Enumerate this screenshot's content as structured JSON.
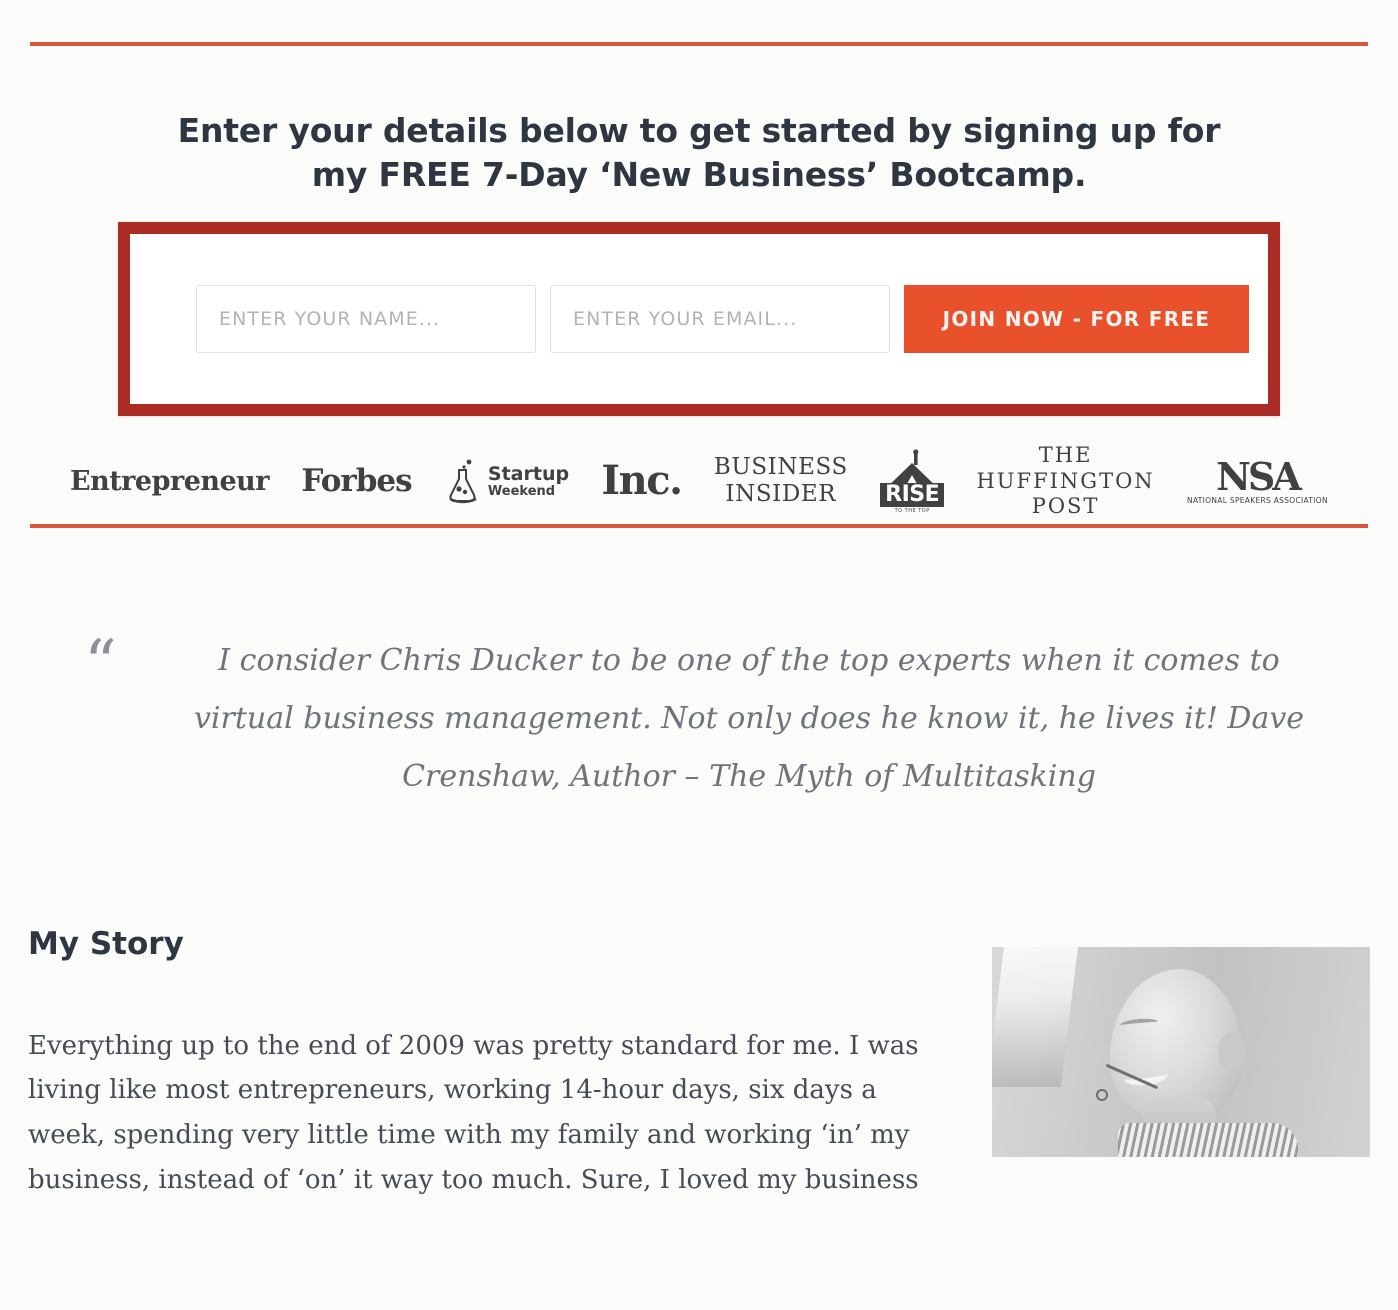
{
  "theme": {
    "rule_color": "#d9563a",
    "form_border_color": "#ab2b25",
    "button_color": "#e8512c",
    "heading_color": "#2e3642",
    "quote_color": "#6e737c"
  },
  "optin": {
    "heading_line1": "Enter your details below to get started by signing up for",
    "heading_line2": "my FREE 7-Day ‘New Business’ Bootcamp.",
    "name_placeholder": "ENTER YOUR NAME...",
    "email_placeholder": "ENTER YOUR EMAIL...",
    "name_value": "",
    "email_value": "",
    "submit_label": "JOIN NOW - FOR FREE"
  },
  "press_logos": [
    {
      "id": "entrepreneur",
      "name": "Entrepreneur"
    },
    {
      "id": "forbes",
      "name": "Forbes"
    },
    {
      "id": "startup-weekend",
      "name": "Startup",
      "name2": "Weekend"
    },
    {
      "id": "inc",
      "name": "Inc."
    },
    {
      "id": "business-insider",
      "name": "BUSINESS",
      "name2": "INSIDER"
    },
    {
      "id": "rise",
      "name": "RISE",
      "name2": "TO THE TOP"
    },
    {
      "id": "huffington-post",
      "name": "THE",
      "name2": "HUFFINGTON",
      "name3": "POST"
    },
    {
      "id": "nsa",
      "name": "NSA",
      "name2": "NATIONAL SPEAKERS ASSOCIATION"
    }
  ],
  "testimonial": {
    "quote_glyph": "“",
    "line1": "I consider Chris Ducker to be one of the top experts when it comes to virtual",
    "line2": "business management. Not only does he know it, he lives it!",
    "attribution": "Dave Crenshaw, Author – The Myth of Multitasking"
  },
  "story": {
    "title": "My Story",
    "paragraph": "Everything up to the end of 2009 was pretty standard for me. I was living like most entrepreneurs, working 14-hour days, six days a week, spending very little time with my family and working ‘in’ my business, instead of ‘on’ it way too much. Sure, I loved my business"
  }
}
